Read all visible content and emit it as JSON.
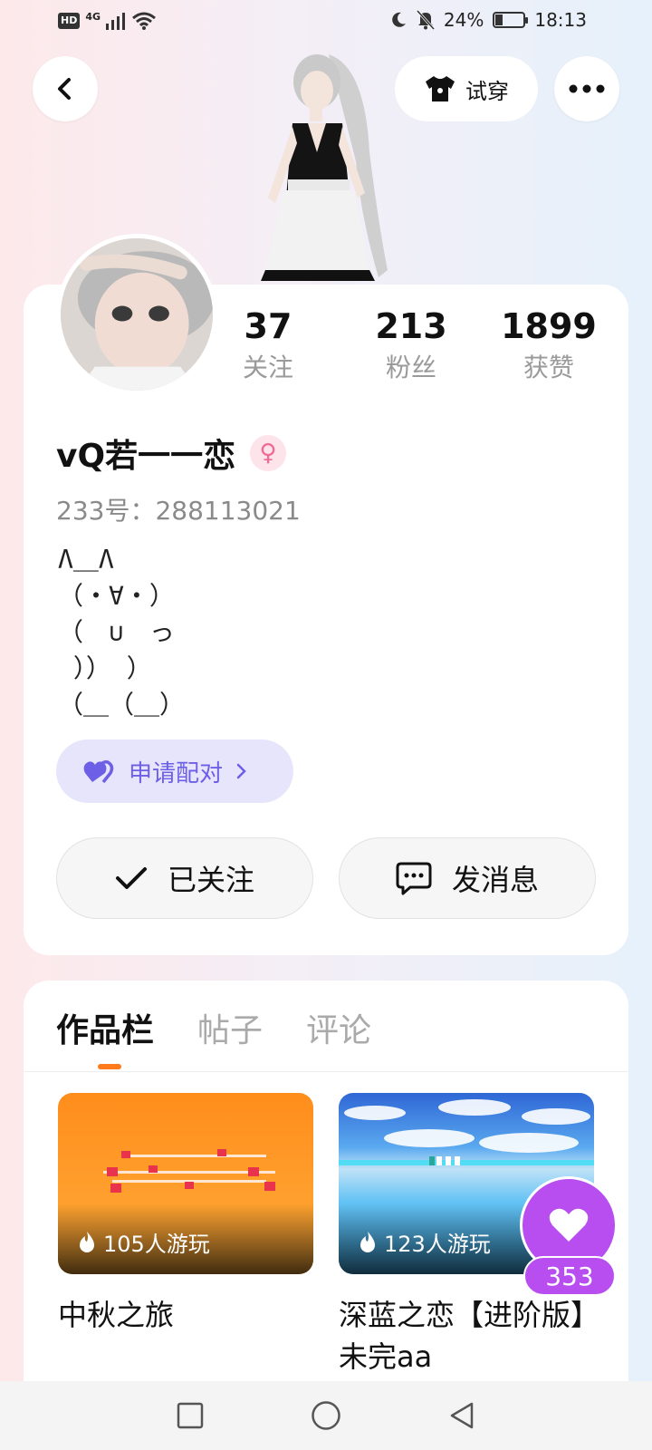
{
  "status_bar": {
    "network_badge": "HD",
    "network_type": "4G",
    "battery_percent": "24%",
    "battery_level": 0.24,
    "time": "18:13",
    "icons": [
      "signal-icon",
      "wifi-icon",
      "moon-icon",
      "mute-bell-icon",
      "battery-icon"
    ]
  },
  "header": {
    "back_icon": "chevron-left-icon",
    "try_on_label": "试穿",
    "try_on_icon": "tshirt-icon",
    "more_icon": "more-dots-icon"
  },
  "profile": {
    "stats": [
      {
        "value": "37",
        "label": "关注"
      },
      {
        "value": "213",
        "label": "粉丝"
      },
      {
        "value": "1899",
        "label": "获赞"
      }
    ],
    "username": "vQ若一一恋",
    "gender_icon": "female-icon",
    "uid": "233号：288113021",
    "bio": "Λ＿Λ\n（・∀・）\n（　∪　っ\n ）） ）\n（＿（＿）",
    "pair_label": "申请配对",
    "followed_label": "已关注",
    "message_label": "发消息"
  },
  "tabs": [
    {
      "label": "作品栏",
      "active": true
    },
    {
      "label": "帖子",
      "active": false
    },
    {
      "label": "评论",
      "active": false
    }
  ],
  "works": [
    {
      "title": "中秋之旅",
      "plays": "105人游玩"
    },
    {
      "title": "深蓝之恋【进阶版】未完aa",
      "plays": "123人游玩"
    }
  ],
  "favorite": {
    "count": "353",
    "icon": "heart-icon"
  },
  "colors": {
    "accent_orange": "#ff7a1a",
    "pair_purple": "#6d5fe6",
    "fav_purple": "#b84df0"
  }
}
